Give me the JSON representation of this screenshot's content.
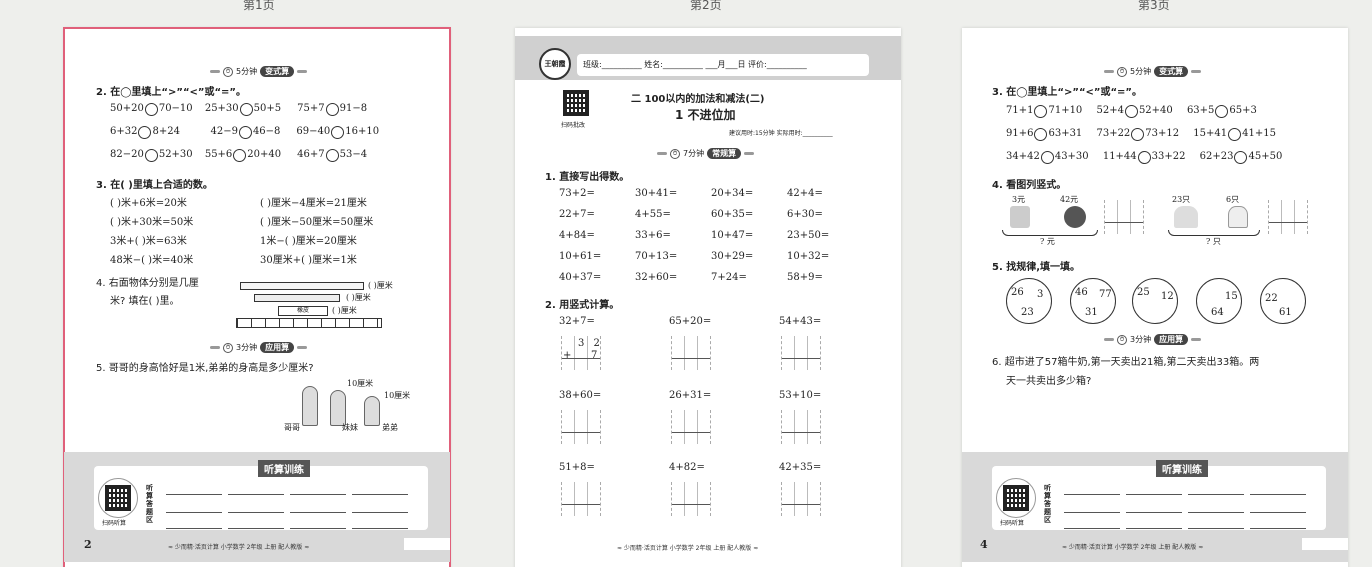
{
  "pages": {
    "p1_label": "第1页",
    "p2_label": "第2页",
    "p3_label": "第3页"
  },
  "p1": {
    "badge_time": "5分钟",
    "badge_type": "变式算",
    "q2_title": "2. 在◯里填上“>”“<”或“=”。",
    "q2_rows": [
      [
        "50+20",
        "70−10",
        "25+30",
        "50+5",
        "75+7",
        "91−8"
      ],
      [
        "6+32",
        "8+24",
        "42−9",
        "46−8",
        "69−40",
        "16+10"
      ],
      [
        "82−20",
        "52+30",
        "55+6",
        "20+40",
        "46+7",
        "53−4"
      ]
    ],
    "q3_title": "3. 在(      )里填上合适的数。",
    "q3_rows": [
      [
        "(      )米+6米=20米",
        "(      )厘米−4厘米=21厘米"
      ],
      [
        "(      )米+30米=50米",
        "(      )厘米−50厘米=50厘米"
      ],
      [
        "3米+(      )米=63米",
        "1米−(      )厘米=20厘米"
      ],
      [
        "48米−(      )米=40米",
        "30厘米+(      )厘米=1米"
      ]
    ],
    "q4_line1": "4. 右面物体分别是几厘",
    "q4_line2": "米? 填在(      )里。",
    "q4_lbl_a": "(      )厘米",
    "q4_lbl_b": "(      )厘米",
    "q4_lbl_c": "(      )厘米",
    "q4_eraser": "橡皮",
    "badge2_time": "3分钟",
    "badge2_type": "应用算",
    "q5_title": "5. 哥哥的身高恰好是1米,弟弟的身高是多少厘米?",
    "q5_a": "10厘米",
    "q5_b": "10厘米",
    "q5_c1": "哥哥",
    "q5_c2": "妹妹",
    "q5_c3": "弟弟",
    "listen_title": "听算训练",
    "listen_side": "听算答题区",
    "qr_caption": "扫码听算",
    "page_no": "2",
    "footer": "≈ 少而精·活页计算 小学数学 2年级 上册 配人教版 ≈"
  },
  "p2": {
    "header_fields": "班级:__________   姓名:__________   ___月___日   评价:__________",
    "logo": "王朝霞",
    "unit_title": "二   100以内的加法和减法(二)",
    "lesson_title": "1  不进位加",
    "suggest": "建议用时:15分钟   实际用时:__________",
    "qr_caption": "扫码批改",
    "badge_time": "7分钟",
    "badge_type": "常规算",
    "q1_title": "1. 直接写出得数。",
    "q1_rows": [
      [
        "73+2=",
        "30+41=",
        "20+34=",
        "42+4="
      ],
      [
        "22+7=",
        "4+55=",
        "60+35=",
        "6+30="
      ],
      [
        "4+84=",
        "33+6=",
        "10+47=",
        "23+50="
      ],
      [
        "10+61=",
        "70+13=",
        "30+29=",
        "10+32="
      ],
      [
        "40+37=",
        "32+60=",
        "7+24=",
        "58+9="
      ]
    ],
    "q2_title": "2. 用竖式计算。",
    "q2_rows": [
      [
        "32+7=",
        "65+20=",
        "54+43="
      ],
      [
        "38+60=",
        "26+31=",
        "53+10="
      ],
      [
        "51+8=",
        "4+82=",
        "42+35="
      ]
    ],
    "demo_top": "3 2",
    "demo_bottom": "7",
    "footer": "≈ 少而精·活页计算 小学数学 2年级 上册 配人教版 ≈"
  },
  "p3": {
    "badge_time": "5分钟",
    "badge_type": "变式算",
    "q3_title": "3. 在◯里填上“>”“<”或“=”。",
    "q3_rows": [
      [
        "71+1",
        "71+10",
        "52+4",
        "52+40",
        "63+5",
        "65+3"
      ],
      [
        "91+6",
        "63+31",
        "73+22",
        "73+12",
        "15+41",
        "41+15"
      ],
      [
        "34+42",
        "43+30",
        "11+44",
        "33+22",
        "62+23",
        "45+50"
      ]
    ],
    "q4_title": "4. 看图列竖式。",
    "q4_p1": "3元",
    "q4_p2": "42元",
    "q4_p3": "? 元",
    "q4_p4": "23只",
    "q4_p5": "6只",
    "q4_p6": "? 只",
    "q5_title": "5. 找规律,填一填。",
    "wheels": [
      [
        "26",
        "3",
        "23"
      ],
      [
        "46",
        "77",
        "31"
      ],
      [
        "25",
        "12",
        ""
      ],
      [
        "",
        "15",
        "64"
      ],
      [
        "22",
        "",
        "61"
      ]
    ],
    "badge2_time": "3分钟",
    "badge2_type": "应用算",
    "q6_line1": "6. 超市进了57箱牛奶,第一天卖出21箱,第二天卖出33箱。两",
    "q6_line2": "天一共卖出多少箱?",
    "listen_title": "听算训练",
    "listen_side": "听算答题区",
    "qr_caption": "扫码听算",
    "page_no": "4",
    "footer": "≈ 少而精·活页计算 小学数学 2年级 上册 配人教版 ≈"
  }
}
